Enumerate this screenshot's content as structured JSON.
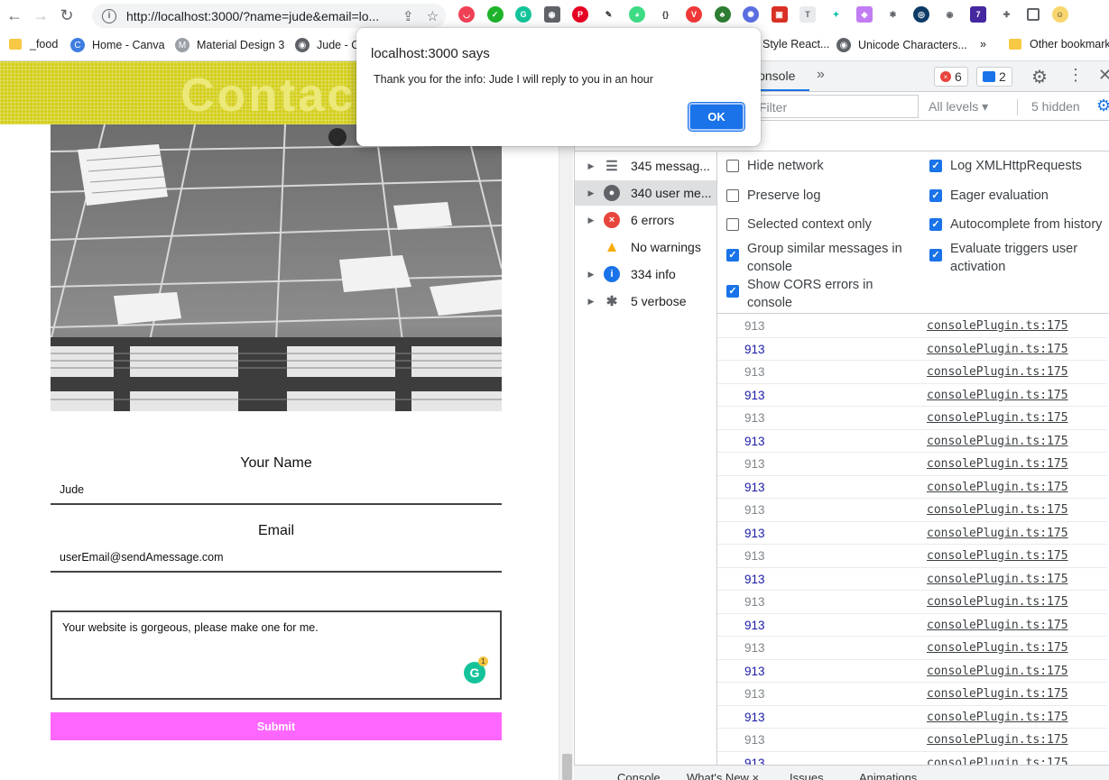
{
  "browser": {
    "url": "http://localhost:3000/?name=jude&email=lo...",
    "extension_icons": [
      "pocket-icon",
      "grammarly-ext-icon",
      "g-icon",
      "camera-icon",
      "pinterest-icon",
      "eyedropper-icon",
      "frog-icon",
      "braces-icon",
      "vivaldi-icon",
      "tree-icon",
      "flower-icon",
      "pdf-icon",
      "text-icon",
      "paint-icon",
      "gradient-icon",
      "bug-icon",
      "eye-code-icon",
      "eye-icon",
      "gem-icon",
      "puzzle-icon",
      "sidebar-icon",
      "avatar-icon"
    ]
  },
  "bookmarks": [
    {
      "label": "_food",
      "icon": "folder-icon"
    },
    {
      "label": "Home - Canva",
      "icon": "canva-icon"
    },
    {
      "label": "Material Design 3",
      "icon": "material-icon"
    },
    {
      "label": "Jude - C",
      "icon": "github-icon"
    },
    {
      "label": "Style React...",
      "icon": ""
    },
    {
      "label": "Unicode Characters...",
      "icon": "github-icon"
    },
    {
      "label": "»",
      "icon": ""
    },
    {
      "label": "Other bookmark",
      "icon": "folder-icon"
    }
  ],
  "page": {
    "banner_title": "Contact",
    "name_label": "Your Name",
    "name_value": "Jude",
    "email_label": "Email",
    "email_value": "userEmail@sendAmessage.com",
    "message_value": "Your website is gorgeous, please make one for me.",
    "grammarly_badge": "1",
    "submit_label": "Submit",
    "colors": {
      "banner": "#d4cf1e",
      "submit": "#ff66ff"
    }
  },
  "dialog": {
    "title": "localhost:3000 says",
    "message": "Thank you for the info: Jude I will reply to you in an hour",
    "ok_label": "OK"
  },
  "devtools": {
    "active_tab": "Console",
    "more_tabs": "»",
    "error_count": "6",
    "message_count": "2",
    "filter_placeholder": "Filter",
    "levels_label": "All levels ▾",
    "hidden_label": "5 hidden",
    "sidebar": [
      {
        "label": "345 messag...",
        "icon": "list-icon",
        "expand": true
      },
      {
        "label": "340 user me...",
        "icon": "user-icon",
        "expand": true,
        "selected": true
      },
      {
        "label": "6 errors",
        "icon": "error-icon",
        "expand": true
      },
      {
        "label": "No warnings",
        "icon": "warning-icon",
        "expand": false
      },
      {
        "label": "334 info",
        "icon": "info-icon",
        "expand": true
      },
      {
        "label": "5 verbose",
        "icon": "bug-icon",
        "expand": true
      }
    ],
    "settings_left": [
      {
        "label": "Hide network",
        "checked": false
      },
      {
        "label": "Preserve log",
        "checked": false
      },
      {
        "label": "Selected context only",
        "checked": false
      },
      {
        "label": "Group similar messages in console",
        "checked": true
      },
      {
        "label": "Show CORS errors in console",
        "checked": true
      }
    ],
    "settings_right": [
      {
        "label": "Log XMLHttpRequests",
        "checked": true
      },
      {
        "label": "Eager evaluation",
        "checked": true
      },
      {
        "label": "Autocomplete from history",
        "checked": true
      },
      {
        "label": "Evaluate triggers user activation",
        "checked": true
      }
    ],
    "log_rows": [
      {
        "value": "913",
        "source": "consolePlugin.ts:175",
        "color": "#80868b"
      },
      {
        "value": "913",
        "source": "consolePlugin.ts:175",
        "color": "#1a1aa6"
      },
      {
        "value": "913",
        "source": "consolePlugin.ts:175",
        "color": "#80868b"
      },
      {
        "value": "913",
        "source": "consolePlugin.ts:175",
        "color": "#1a1aa6"
      },
      {
        "value": "913",
        "source": "consolePlugin.ts:175",
        "color": "#80868b"
      },
      {
        "value": "913",
        "source": "consolePlugin.ts:175",
        "color": "#1a1aa6"
      },
      {
        "value": "913",
        "source": "consolePlugin.ts:175",
        "color": "#80868b"
      },
      {
        "value": "913",
        "source": "consolePlugin.ts:175",
        "color": "#1a1aa6"
      },
      {
        "value": "913",
        "source": "consolePlugin.ts:175",
        "color": "#80868b"
      },
      {
        "value": "913",
        "source": "consolePlugin.ts:175",
        "color": "#1a1aa6"
      },
      {
        "value": "913",
        "source": "consolePlugin.ts:175",
        "color": "#80868b"
      },
      {
        "value": "913",
        "source": "consolePlugin.ts:175",
        "color": "#1a1aa6"
      },
      {
        "value": "913",
        "source": "consolePlugin.ts:175",
        "color": "#80868b"
      },
      {
        "value": "913",
        "source": "consolePlugin.ts:175",
        "color": "#1a1aa6"
      },
      {
        "value": "913",
        "source": "consolePlugin.ts:175",
        "color": "#80868b"
      },
      {
        "value": "913",
        "source": "consolePlugin.ts:175",
        "color": "#1a1aa6"
      },
      {
        "value": "913",
        "source": "consolePlugin.ts:175",
        "color": "#80868b"
      },
      {
        "value": "913",
        "source": "consolePlugin.ts:175",
        "color": "#1a1aa6"
      },
      {
        "value": "913",
        "source": "consolePlugin.ts:175",
        "color": "#80868b"
      },
      {
        "value": "913",
        "source": "consolePlugin.ts:175",
        "color": "#1a1aa6"
      }
    ],
    "drawer_tabs": [
      "Console",
      "What's New ×",
      "Issues",
      "Animations"
    ]
  }
}
